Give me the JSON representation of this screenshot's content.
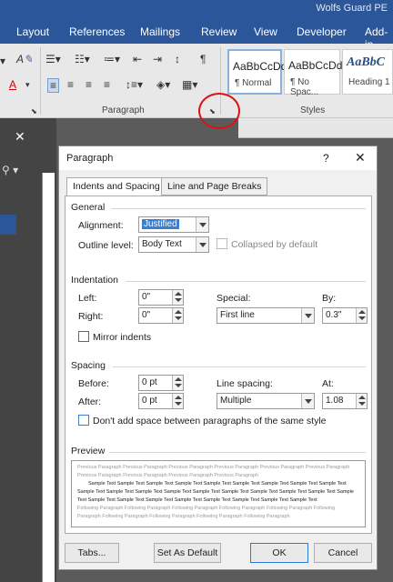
{
  "app": {
    "title": "Wolfs Guard PE"
  },
  "ribbon": {
    "tabs": [
      "Layout",
      "References",
      "Mailings",
      "Review",
      "View",
      "Developer",
      "Add-in"
    ],
    "paragraph_group": "Paragraph",
    "styles_group": "Styles",
    "styles": [
      {
        "preview": "AaBbCcDd",
        "name": "¶ Normal"
      },
      {
        "preview": "AaBbCcDd",
        "name": "¶ No Spac..."
      },
      {
        "preview": "AaBbC",
        "name": "Heading 1"
      }
    ]
  },
  "dialog": {
    "title": "Paragraph",
    "help": "?",
    "close": "✕",
    "tabs": [
      "Indents and Spacing",
      "Line and Page Breaks"
    ],
    "general": {
      "heading": "General",
      "alignment_label": "Alignment:",
      "alignment_value": "Justified",
      "outline_label": "Outline level:",
      "outline_value": "Body Text",
      "collapsed_label": "Collapsed by default"
    },
    "indentation": {
      "heading": "Indentation",
      "left_label": "Left:",
      "left_value": "0\"",
      "right_label": "Right:",
      "right_value": "0\"",
      "special_label": "Special:",
      "special_value": "First line",
      "by_label": "By:",
      "by_value": "0.3\"",
      "mirror_label": "Mirror indents"
    },
    "spacing": {
      "heading": "Spacing",
      "before_label": "Before:",
      "before_value": "0 pt",
      "after_label": "After:",
      "after_value": "0 pt",
      "line_spacing_label": "Line spacing:",
      "line_spacing_value": "Multiple",
      "at_label": "At:",
      "at_value": "1.08",
      "dont_add_label": "Don't add space between paragraphs of the same style"
    },
    "preview": {
      "heading": "Preview",
      "previous": "Previous Paragraph Previous Paragraph Previous Paragraph Previous Paragraph Previous Paragraph Previous Paragraph Previous Paragraph Previous Paragraph Previous Paragraph Previous Paragraph",
      "sample": "Sample Text Sample Text Sample Text Sample Text Sample Text Sample Text Sample Text Sample Text Sample Text Sample Text Sample Text Sample Text Sample Text Sample Text Sample Text Sample Text Sample Text Sample Text Sample Text Sample Text Sample Text Sample Text Sample Text Sample Text Sample Text Sample Text Sample Text",
      "following": "Following Paragraph Following Paragraph Following Paragraph Following Paragraph Following Paragraph Following Paragraph Following Paragraph Following Paragraph Following Paragraph Following Paragraph"
    },
    "buttons": {
      "tabs": "Tabs...",
      "set_default": "Set As Default",
      "ok": "OK",
      "cancel": "Cancel"
    }
  },
  "colors": {
    "ribbon_blue": "#2b579a",
    "highlight": "#3c7fd1",
    "annotation": "#dd1111"
  }
}
